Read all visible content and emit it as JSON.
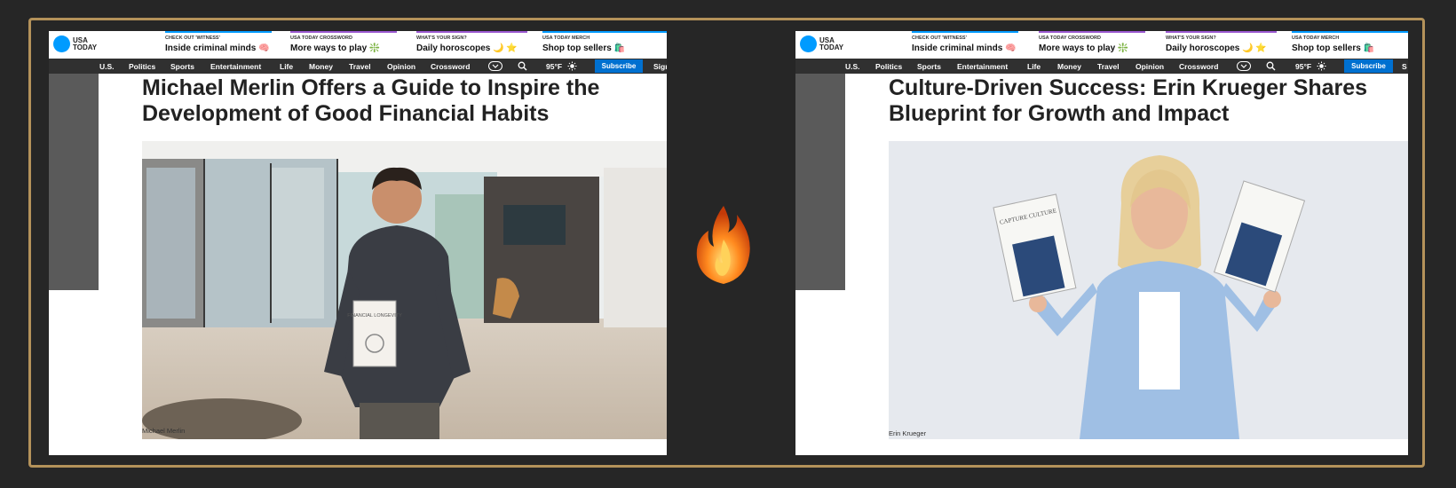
{
  "left": {
    "logo": {
      "line1": "USA",
      "line2": "TODAY"
    },
    "promos": [
      {
        "kicker": "CHECK OUT 'WITNESS'",
        "title": "Inside criminal minds 🧠"
      },
      {
        "kicker": "USA TODAY CROSSWORD",
        "title": "More ways to play ❇️"
      },
      {
        "kicker": "WHAT'S YOUR SIGN?",
        "title": "Daily horoscopes 🌙 ⭐"
      },
      {
        "kicker": "USA TODAY MERCH",
        "title": "Shop top sellers 🛍️"
      }
    ],
    "nav": [
      "U.S.",
      "Politics",
      "Sports",
      "Entertainment",
      "Life",
      "Money",
      "Travel",
      "Opinion",
      "Crossword"
    ],
    "weather": "95°F",
    "subscribe": "Subscribe",
    "signin": "Sign",
    "headline": "Michael Merlin Offers a Guide to Inspire the Development of Good Financial Habits",
    "book_title": "FINANCIAL LONGEVITY",
    "caption": "Michael Merlin"
  },
  "right": {
    "logo": {
      "line1": "USA",
      "line2": "TODAY"
    },
    "promos": [
      {
        "kicker": "CHECK OUT 'WITNESS'",
        "title": "Inside criminal minds 🧠"
      },
      {
        "kicker": "USA TODAY CROSSWORD",
        "title": "More ways to play ❇️"
      },
      {
        "kicker": "WHAT'S YOUR SIGN?",
        "title": "Daily horoscopes 🌙 ⭐"
      },
      {
        "kicker": "USA TODAY MERCH",
        "title": "Shop top sellers 🛍️"
      }
    ],
    "nav": [
      "U.S.",
      "Politics",
      "Sports",
      "Entertainment",
      "Life",
      "Money",
      "Travel",
      "Opinion",
      "Crossword"
    ],
    "weather": "95°F",
    "subscribe": "Subscribe",
    "signin": "S",
    "headline": "Culture-Driven Success: Erin Krueger Shares Blueprint for Growth and Impact",
    "book_title": "CAPTURE CULTURE",
    "caption": "Erin Krueger"
  },
  "colors": {
    "frame": "#b4925a",
    "background": "#262626",
    "navbar": "#303030",
    "subscribe": "#0070d0",
    "logo": "#009bff"
  },
  "icons": {
    "center": "fire-icon"
  }
}
